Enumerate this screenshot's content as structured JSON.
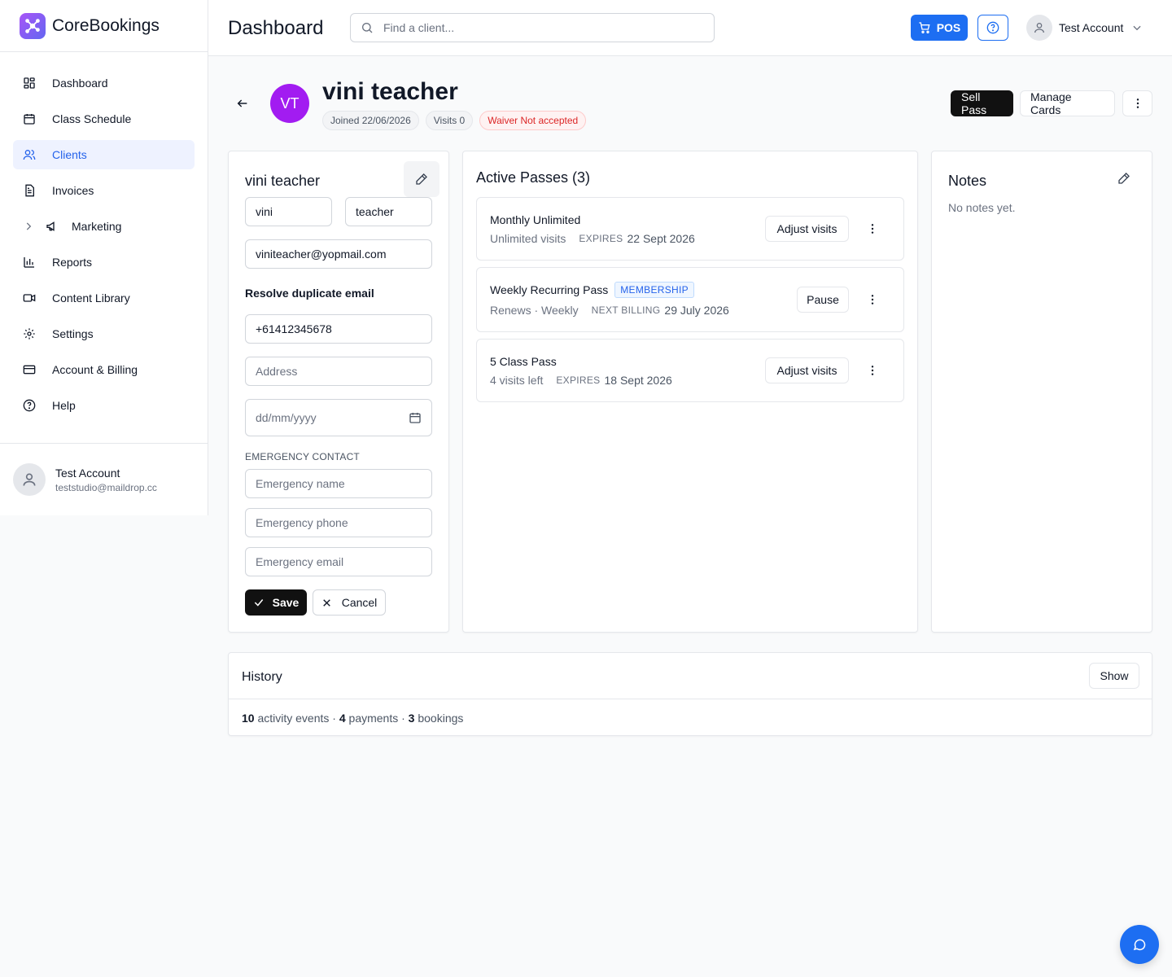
{
  "brand": {
    "name": "CoreBookings"
  },
  "sidebar": {
    "items": [
      {
        "label": "Dashboard",
        "icon": "dashboard-icon"
      },
      {
        "label": "Class Schedule",
        "icon": "calendar-icon"
      },
      {
        "label": "Clients",
        "icon": "users-icon",
        "active": true
      },
      {
        "label": "Invoices",
        "icon": "invoice-icon"
      },
      {
        "label": "Marketing",
        "icon": "megaphone-icon"
      },
      {
        "label": "Reports",
        "icon": "bar-chart-icon"
      },
      {
        "label": "Content Library",
        "icon": "video-icon"
      },
      {
        "label": "Settings",
        "icon": "gear-icon"
      },
      {
        "label": "Account & Billing",
        "icon": "credit-card-icon"
      },
      {
        "label": "Help",
        "icon": "help-circle-icon"
      }
    ],
    "user": {
      "name": "Test Account",
      "email": "teststudio@maildrop.cc"
    }
  },
  "topbar": {
    "title": "Dashboard",
    "search_placeholder": "Find a client...",
    "pos_label": "POS",
    "user_name": "Test Account"
  },
  "client": {
    "initials": "VT",
    "name": "vini teacher",
    "joined": "Joined 22/06/2026",
    "visits": "Visits 0",
    "waiver": "Waiver Not accepted"
  },
  "actions": {
    "sell_pass": "Sell Pass",
    "manage_cards": "Manage Cards"
  },
  "form": {
    "title": "vini teacher",
    "first_name": "vini",
    "last_name": "teacher",
    "email": "viniteacher@yopmail.com",
    "duplicate_label": "Resolve duplicate email",
    "phone": "+61412345678",
    "address_placeholder": "Address",
    "dob_placeholder": "dd/mm/yyyy",
    "emergency_heading": "EMERGENCY CONTACT",
    "emergency_name_placeholder": "Emergency name",
    "emergency_phone_placeholder": "Emergency phone",
    "emergency_email_placeholder": "Emergency email",
    "save_label": "Save",
    "cancel_label": "Cancel"
  },
  "passes": {
    "title": "Active Passes (3)",
    "items": [
      {
        "name": "Monthly Unlimited",
        "badge": "",
        "sub": "Unlimited visits",
        "cap": "EXPIRES",
        "date": "22 Sept 2026",
        "action": "Adjust visits"
      },
      {
        "name": "Weekly Recurring Pass",
        "badge": "MEMBERSHIP",
        "sub": "Renews · Weekly",
        "cap": "NEXT BILLING",
        "date": "29 July 2026",
        "action": "Pause"
      },
      {
        "name": "5 Class Pass",
        "badge": "",
        "sub": "4 visits left",
        "cap": "EXPIRES",
        "date": "18 Sept 2026",
        "action": "Adjust visits"
      }
    ]
  },
  "notes": {
    "title": "Notes",
    "empty": "No notes yet."
  },
  "history": {
    "title": "History",
    "show_label": "Show",
    "activity_count": "10",
    "activity_label": " activity events · ",
    "payment_count": "4",
    "payment_label": " payments · ",
    "booking_count": "3",
    "booking_label": " bookings"
  },
  "colors": {
    "primary": "#1d6ef2",
    "avatar": "#a21cf1",
    "dark_button": "#111111",
    "warning": "#dc2626"
  }
}
